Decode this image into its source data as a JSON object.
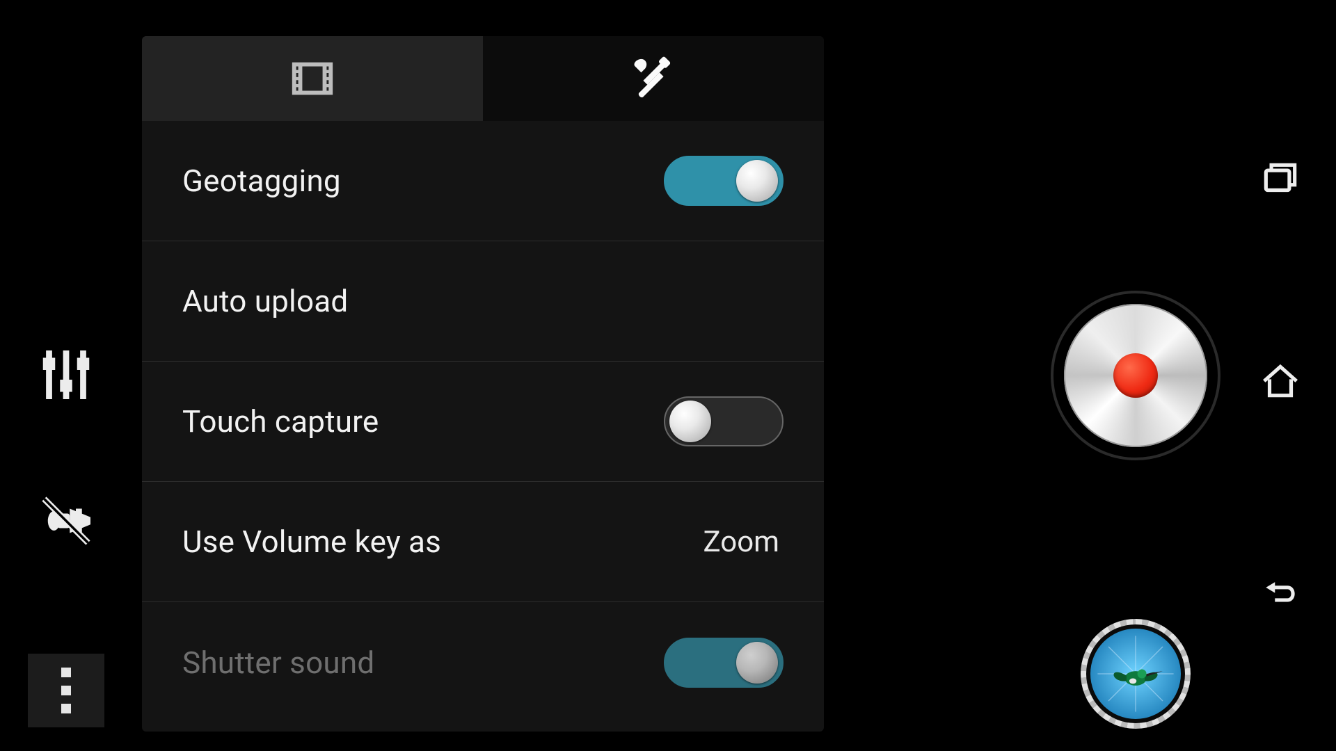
{
  "tabs": {
    "video_tab_icon": "film-icon",
    "tools_tab_icon": "tools-icon",
    "active_index": 1
  },
  "settings": [
    {
      "key": "geotagging",
      "label": "Geotagging",
      "type": "toggle",
      "value": true,
      "disabled": false
    },
    {
      "key": "auto_upload",
      "label": "Auto upload",
      "type": "nav",
      "disabled": false
    },
    {
      "key": "touch_capture",
      "label": "Touch capture",
      "type": "toggle",
      "value": false,
      "disabled": false
    },
    {
      "key": "volume_key",
      "label": "Use Volume key as",
      "type": "select",
      "value": "Zoom",
      "disabled": false
    },
    {
      "key": "shutter_sound",
      "label": "Shutter sound",
      "type": "toggle",
      "value": true,
      "disabled": true
    }
  ],
  "left_rail": {
    "sliders_icon": "adjust-sliders-icon",
    "flash_icon": "flash-off-icon",
    "overflow_icon": "overflow-menu-icon"
  },
  "right_controls": {
    "shutter": "record-button",
    "gallery_thumbnail": "hummingbird-blue",
    "nav": {
      "recents": "recents-icon",
      "home": "home-icon",
      "back": "back-icon"
    }
  },
  "colors": {
    "toggle_on": "#2f91a9",
    "record_dot": "#ef2b14",
    "panel_bg": "#141414"
  }
}
